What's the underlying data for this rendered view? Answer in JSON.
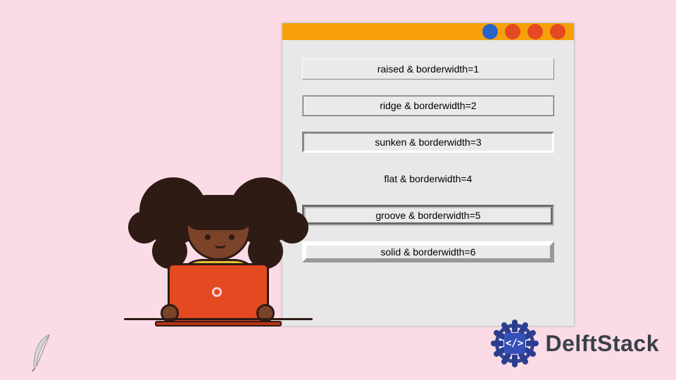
{
  "window": {
    "titlebar": {
      "button_colors": [
        "blue",
        "red",
        "red",
        "red"
      ]
    },
    "labels": [
      {
        "text": "raised & borderwidth=1",
        "relief": "raised",
        "borderwidth": 1
      },
      {
        "text": "ridge & borderwidth=2",
        "relief": "ridge",
        "borderwidth": 2
      },
      {
        "text": "sunken & borderwidth=3",
        "relief": "sunken",
        "borderwidth": 3
      },
      {
        "text": "flat & borderwidth=4",
        "relief": "flat",
        "borderwidth": 4
      },
      {
        "text": "groove & borderwidth=5",
        "relief": "groove",
        "borderwidth": 5
      },
      {
        "text": "solid & borderwidth=6",
        "relief": "solid",
        "borderwidth": 6
      }
    ]
  },
  "brand": {
    "code_glyph": "</>",
    "name": "DelftStack"
  },
  "icons": {
    "feather": "feather-icon"
  }
}
